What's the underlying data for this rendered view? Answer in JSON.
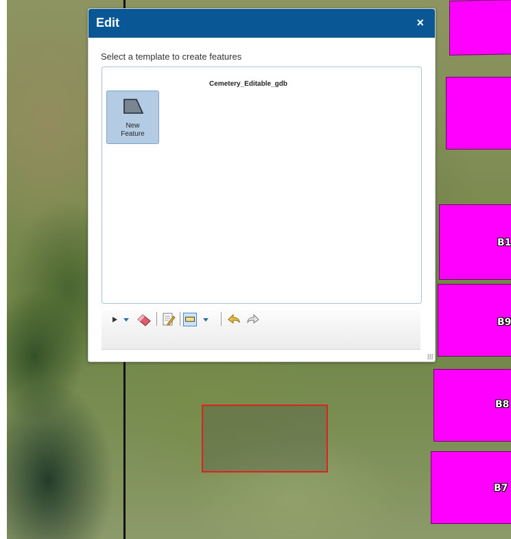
{
  "dialog": {
    "title": "Edit",
    "close_glyph": "×",
    "instruction": "Select a template to create features",
    "layer_name": "Cemetery_Editable_gdb",
    "templates": [
      {
        "label_line1": "New",
        "label_line2": "Feature",
        "icon": "polygon-icon",
        "selected": true
      }
    ],
    "toolbar": {
      "tools": [
        "select-tool-icon",
        "select-dropdown-icon",
        "eraser-icon",
        "attributes-icon",
        "draw-shape-icon",
        "shape-dropdown-icon",
        "undo-icon",
        "redo-icon"
      ]
    }
  },
  "map": {
    "plot_labels": [
      "B1",
      "B9",
      "B8",
      "B7"
    ],
    "colors": {
      "plot_fill": "#ff00ff",
      "selection_outline": "#e0201a",
      "header": "#0a5796"
    }
  }
}
